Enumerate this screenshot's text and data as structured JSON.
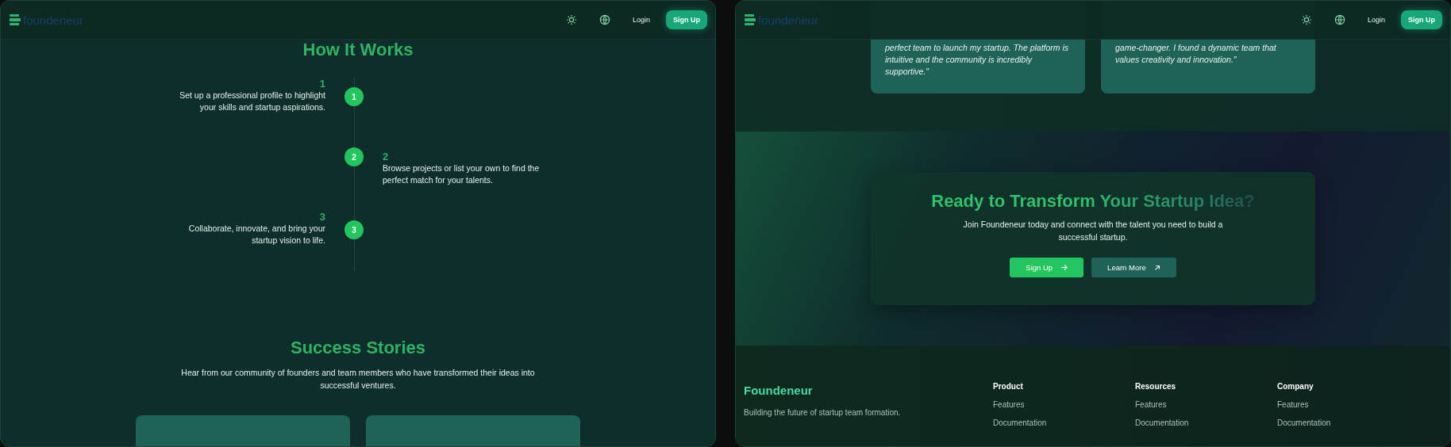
{
  "left_page": {
    "header": {
      "logo": "foundeneur",
      "login": "Login",
      "signup": "Sign Up"
    },
    "title": "How It Works",
    "steps": [
      {
        "number": "1",
        "circle_label": "1",
        "text": "Set up a professional profile to highlight your skills and startup aspirations.",
        "kind": "left"
      },
      {
        "number": "2",
        "circle_label": "2",
        "text": "Browse projects or list your own to find the perfect match for your talents.",
        "kind": "right"
      },
      {
        "number": "3",
        "circle_label": "3",
        "text": "Collaborate, innovate, and bring your startup vision to life.",
        "kind": "left"
      }
    ],
    "success": {
      "title": "Success Stories",
      "subtitle": "Hear from our community of founders and team members who have transformed their ideas into successful ventures.",
      "cards": [
        {
          "kind": "card"
        },
        {
          "kind": "card"
        }
      ]
    }
  },
  "right_page": {
    "header": {
      "logo": "foundeneur",
      "login": "Login",
      "signup": "Sign Up"
    },
    "testimonials": [
      {
        "quote": "perfect team to launch my startup. The platform is intuitive and the community is incredibly supportive.\""
      },
      {
        "quote": "game-changer. I found a dynamic team that values creativity and innovation.\""
      }
    ],
    "cta": {
      "title": "Ready to Transform Your Startup Idea?",
      "text": "Join Foundeneur today and connect with the talent you need to build a successful startup.",
      "primary": "Sign Up",
      "secondary": "Learn More"
    },
    "footer": {
      "brand": "Foundeneur",
      "tagline": "Building the future of startup team formation.",
      "columns": [
        {
          "heading": "Product",
          "links": [
            "Features",
            "Documentation"
          ]
        },
        {
          "heading": "Resources",
          "links": [
            "Features",
            "Documentation"
          ]
        },
        {
          "heading": "Company",
          "links": [
            "Features",
            "Documentation"
          ]
        }
      ]
    }
  }
}
